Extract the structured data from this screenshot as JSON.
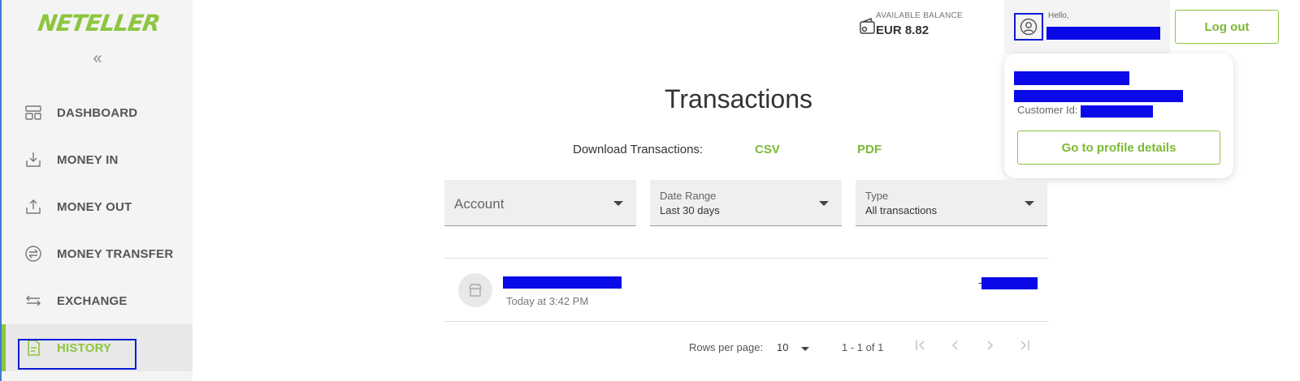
{
  "brand": {
    "logo_text": "NETELLER",
    "accent": "#8dc63f"
  },
  "sidebar": {
    "collapse_glyph": "«",
    "items": [
      {
        "label": "DASHBOARD",
        "icon": "dashboard-icon"
      },
      {
        "label": "MONEY IN",
        "icon": "money-in-icon"
      },
      {
        "label": "MONEY OUT",
        "icon": "money-out-icon"
      },
      {
        "label": "MONEY TRANSFER",
        "icon": "transfer-icon"
      },
      {
        "label": "EXCHANGE",
        "icon": "exchange-icon"
      },
      {
        "label": "HISTORY",
        "icon": "history-icon",
        "active": true
      }
    ]
  },
  "header": {
    "balance_label": "AVAILABLE BALANCE",
    "balance_value": "EUR 8.82",
    "hello": "Hello,",
    "logout": "Log out"
  },
  "profile_popup": {
    "customer_id_label": "Customer Id:",
    "profile_button": "Go to profile details"
  },
  "main": {
    "title": "Transactions",
    "download_label": "Download Transactions:",
    "download_csv": "CSV",
    "download_pdf": "PDF",
    "filters": {
      "account_placeholder": "Account",
      "date_range_label": "Date Range",
      "date_range_value": "Last 30 days",
      "type_label": "Type",
      "type_value": "All transactions"
    },
    "transactions": [
      {
        "time": "Today at 3:42 PM",
        "amount_prefix": "-"
      }
    ],
    "pagination": {
      "rows_label": "Rows per page:",
      "rows_value": "10",
      "range": "1 - 1 of 1"
    }
  }
}
